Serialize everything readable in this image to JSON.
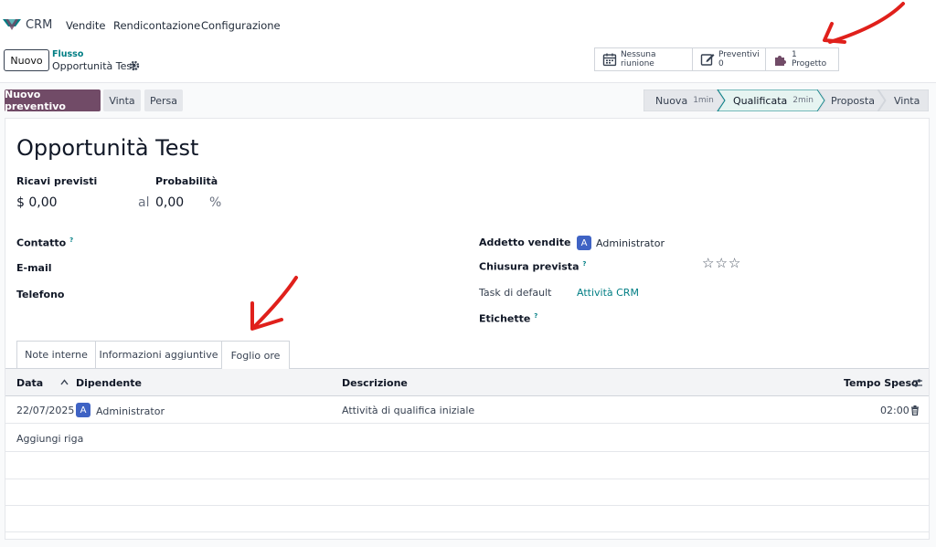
{
  "navbar": {
    "app_name": "CRM",
    "menu": [
      "Vendite",
      "Rendicontazione",
      "Configurazione"
    ]
  },
  "control_panel": {
    "new_button": "Nuovo",
    "breadcrumb_parent": "Flusso",
    "breadcrumb_current": "Opportunità Test",
    "smart_buttons": {
      "meetings": "Nessuna riunione",
      "quotes_label": "Preventivi",
      "quotes_count": "0",
      "project_count": "1",
      "project_label": "Progetto"
    }
  },
  "actions": {
    "new_quote": "Nuovo preventivo",
    "won": "Vinta",
    "lost": "Persa"
  },
  "stages": [
    {
      "label": "Nuova",
      "duration": "1min"
    },
    {
      "label": "Qualificata",
      "duration": "2min"
    },
    {
      "label": "Proposta",
      "duration": ""
    },
    {
      "label": "Vinta",
      "duration": ""
    }
  ],
  "active_stage": "Qualificata",
  "form": {
    "title": "Opportunità Test",
    "expected_revenue_label": "Ricavi previsti",
    "expected_revenue_value": "$ 0,00",
    "at_label": "al",
    "probability_label": "Probabilità",
    "probability_value": "0,00",
    "percent_sign": "%",
    "contact_label": "Contatto",
    "tooltip_mark": "?",
    "email_label": "E-mail",
    "phone_label": "Telefono",
    "salesperson_label": "Addetto vendite",
    "salesperson_initial": "A",
    "salesperson_name": "Administrator",
    "expected_closing_label": "Chiusura prevista",
    "priority_stars": "☆☆☆",
    "default_task_label": "Task di default",
    "default_task_value": "Attività CRM",
    "tags_label": "Etichette"
  },
  "tabs": [
    "Note interne",
    "Informazioni aggiuntive",
    "Foglio ore"
  ],
  "active_tab": "Foglio ore",
  "timesheet": {
    "columns": [
      "Data",
      "Dipendente",
      "Descrizione",
      "Tempo Speso"
    ],
    "rows": [
      {
        "date": "22/07/2025",
        "employee_initial": "A",
        "employee": "Administrator",
        "description": "Attività di qualifica iniziale",
        "time": "02:00"
      }
    ],
    "add_line": "Aggiungi riga"
  },
  "colors": {
    "primary": "#714b67",
    "accent": "#017e84",
    "avatar": "#3f63c4",
    "annotation_arrow": "#e0201b"
  }
}
